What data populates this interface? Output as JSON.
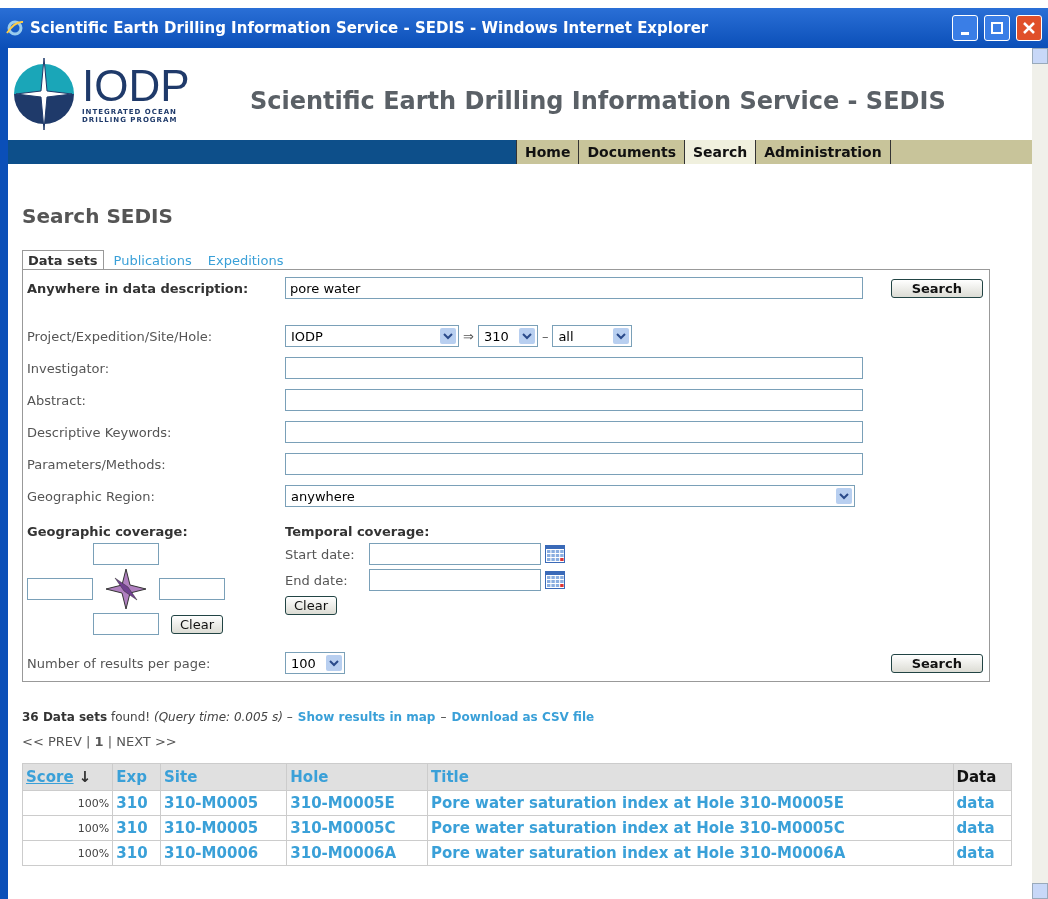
{
  "window": {
    "title": "Scientific Earth Drilling Information Service - SEDIS - Windows Internet Explorer"
  },
  "header": {
    "logo_text": "IODP",
    "logo_sub": [
      "INTEGRATED OCEAN",
      "DRILLING PROGRAM"
    ],
    "site_title": "Scientific Earth Drilling Information Service - SEDIS"
  },
  "nav": [
    {
      "label": "Home",
      "selected": false
    },
    {
      "label": "Documents",
      "selected": false
    },
    {
      "label": "Search",
      "selected": true
    },
    {
      "label": "Administration",
      "selected": false
    }
  ],
  "heading": "Search SEDIS",
  "tabs": [
    {
      "label": "Data sets",
      "selected": true
    },
    {
      "label": "Publications",
      "selected": false
    },
    {
      "label": "Expeditions",
      "selected": false
    }
  ],
  "query": {
    "label": "Anywhere in data description:",
    "value": "pore water",
    "button": "Search"
  },
  "fields": [
    {
      "kind": "selects",
      "label": "Project/Expedition/Site/Hole:",
      "selects": [
        {
          "value": "IODP"
        },
        {
          "value": "310"
        },
        {
          "value": "all"
        }
      ],
      "separators": [
        "⇒",
        "–"
      ]
    },
    {
      "kind": "text",
      "label": "Investigator:"
    },
    {
      "kind": "text",
      "label": "Abstract:"
    },
    {
      "kind": "text",
      "label": "Descriptive Keywords:"
    },
    {
      "kind": "text",
      "label": "Parameters/Methods:"
    },
    {
      "kind": "select",
      "label": "Geographic Region:",
      "value": "anywhere"
    }
  ],
  "geographic": {
    "label": "Geographic coverage:",
    "button": "Clear"
  },
  "temporal": {
    "label": "Temporal coverage:",
    "start": "Start date:",
    "end": "End date:",
    "button": "Clear"
  },
  "per_page": {
    "label": "Number of results per page:",
    "value": "100",
    "button": "Search"
  },
  "summary": {
    "text": "**36 Data sets** found! *(Query time: 0.005 s)* –",
    "links": [
      "Show results in map",
      "Download as CSV file"
    ],
    "separator": "–"
  },
  "pager": "<< PREV | **1** | NEXT >>",
  "table": {
    "columns": [
      {
        "label": "Score",
        "sort": "↓",
        "link": true
      },
      {
        "label": "Exp",
        "link": true
      },
      {
        "label": "Site",
        "link": true
      },
      {
        "label": "Hole",
        "link": true
      },
      {
        "label": "Title",
        "link": true
      },
      {
        "label": "Data",
        "link": false
      }
    ],
    "rows": [
      [
        "100%",
        "310",
        "310-M0005",
        "310-M0005E",
        "Pore water saturation index at Hole 310-M0005E",
        "data"
      ],
      [
        "100%",
        "310",
        "310-M0005",
        "310-M0005C",
        "Pore water saturation index at Hole 310-M0005C",
        "data"
      ],
      [
        "100%",
        "310",
        "310-M0006",
        "310-M0006A",
        "Pore water saturation index at Hole 310-M0006A",
        "data"
      ]
    ]
  }
}
